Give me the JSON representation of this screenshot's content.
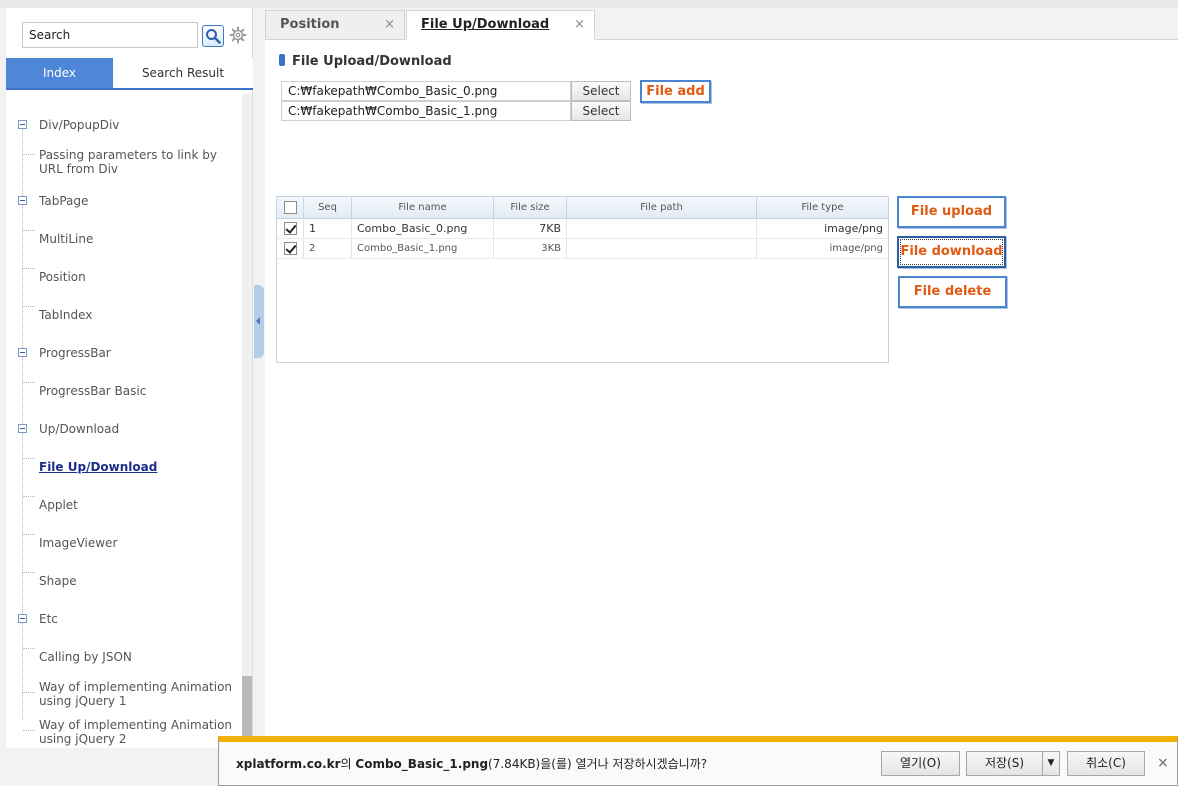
{
  "sidebar": {
    "search": {
      "value": "Search"
    },
    "tabs": [
      {
        "label": "Index"
      },
      {
        "label": "Search Result"
      }
    ],
    "tree": [
      {
        "label": "Div/PopupDiv"
      },
      {
        "label": "Passing parameters to link by URL from Div"
      },
      {
        "label": "TabPage"
      },
      {
        "label": "MultiLine"
      },
      {
        "label": "Position"
      },
      {
        "label": "TabIndex"
      },
      {
        "label": "ProgressBar"
      },
      {
        "label": "ProgressBar Basic"
      },
      {
        "label": "Up/Download"
      },
      {
        "label": "File Up/Download"
      },
      {
        "label": "Applet"
      },
      {
        "label": "ImageViewer"
      },
      {
        "label": "Shape"
      },
      {
        "label": "Etc"
      },
      {
        "label": "Calling by JSON"
      },
      {
        "label": "Way of implementing Animation using jQuery 1"
      },
      {
        "label": "Way of implementing Animation using jQuery 2"
      }
    ]
  },
  "main": {
    "tabs": [
      {
        "label": "Position",
        "close": "×"
      },
      {
        "label": "File Up/Download",
        "close": "×"
      }
    ],
    "title": "File Upload/Download",
    "files": [
      {
        "path": "C:₩fakepath₩Combo_Basic_0.png",
        "button": "Select"
      },
      {
        "path": "C:₩fakepath₩Combo_Basic_1.png",
        "button": "Select"
      }
    ],
    "file_add": "File add",
    "grid": {
      "headers": [
        "Seq",
        "File name",
        "File size",
        "File path",
        "File type"
      ],
      "rows": [
        {
          "seq": "1",
          "name": "Combo_Basic_0.png",
          "size": "7KB",
          "path": "",
          "type": "image/png",
          "checked": true
        },
        {
          "seq": "2",
          "name": "Combo_Basic_1.png",
          "size": "3KB",
          "path": "",
          "type": "image/png",
          "checked": true
        }
      ]
    },
    "buttons": {
      "upload": "File upload",
      "download": "File download",
      "delete": "File delete"
    }
  },
  "download_bar": {
    "site": "xplatform.co.kr",
    "particle": "의 ",
    "file": "Combo_Basic_1.png",
    "rest": "(7.84KB)을(를) 열거나 저장하시겠습니까?",
    "open": "열기(O)",
    "save": "저장(S)",
    "dropdown": "▼",
    "cancel": "취소(C)",
    "close": "×",
    "accent": "#f1b100"
  }
}
